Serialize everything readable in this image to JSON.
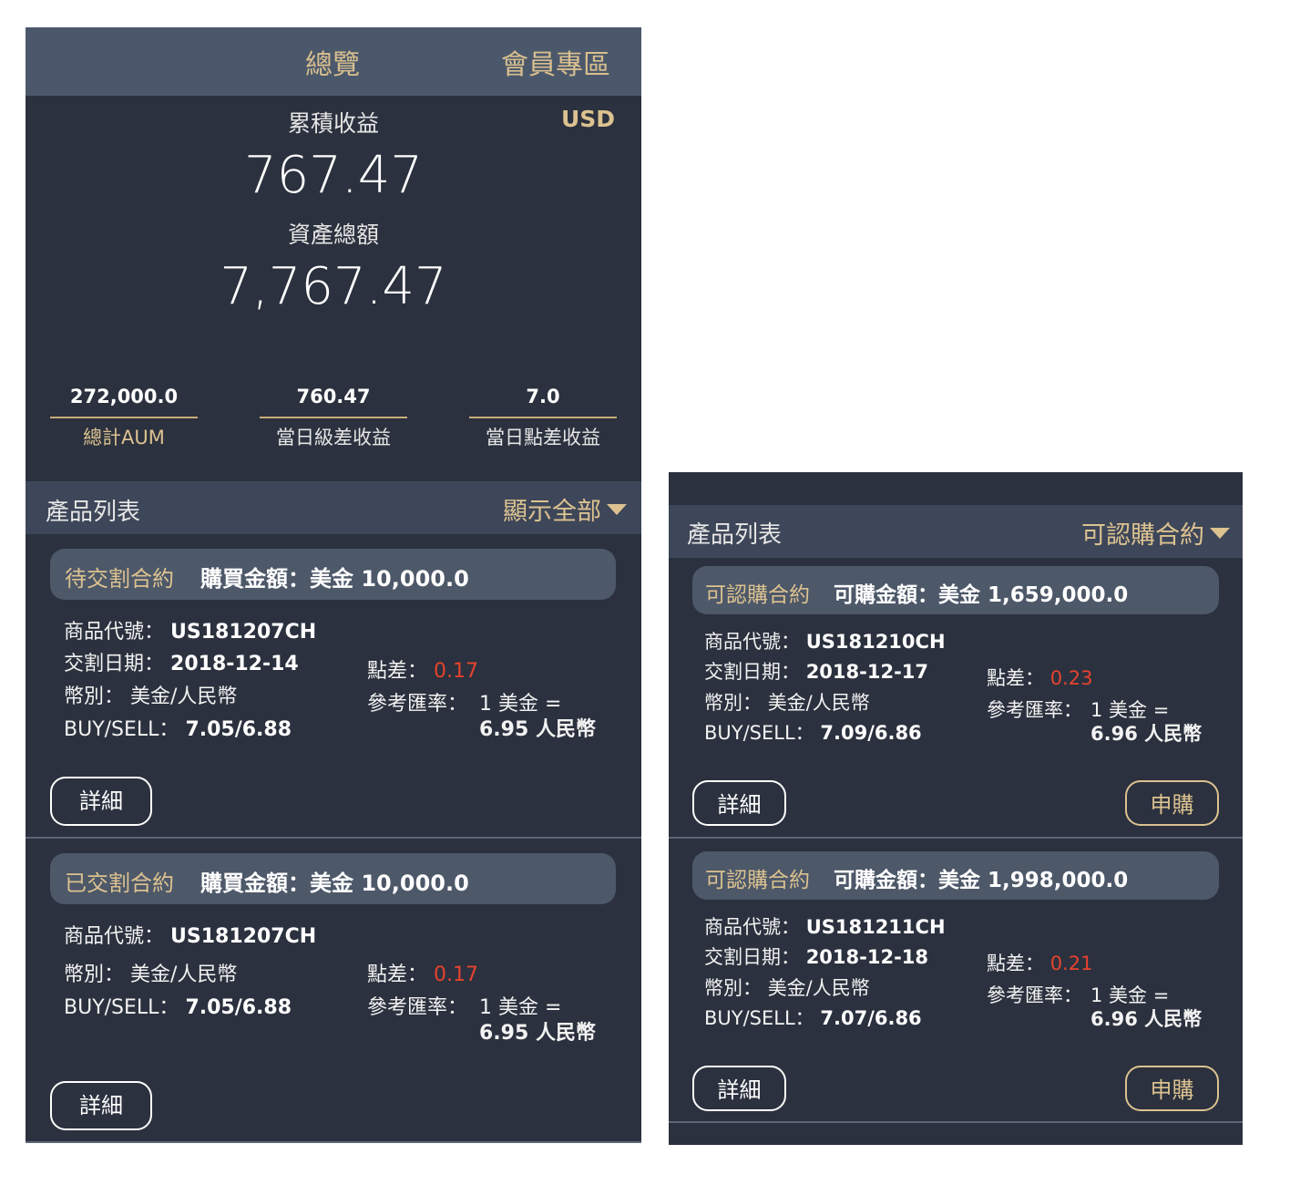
{
  "overview": {
    "tab_overview": "總覽",
    "tab_member": "會員專區",
    "accumulated_label": "累積收益",
    "currency": "USD",
    "accumulated_value": "767.47",
    "total_assets_label": "資產總額",
    "total_assets_value": "7,767.47",
    "stats": [
      {
        "value": "272,000.0",
        "label": "總計AUM"
      },
      {
        "value": "760.47",
        "label": "當日級差收益"
      },
      {
        "value": "7.0",
        "label": "當日點差收益"
      }
    ]
  },
  "left_list": {
    "title": "產品列表",
    "filter": "顯示全部",
    "cards": [
      {
        "kind": "待交割合約",
        "amount": "購買金額：美金 10,000.0",
        "code_label": "商品代號：",
        "code": "US181207CH",
        "date_label": "交割日期：",
        "date": "2018-12-14",
        "currency_label": "幣別：",
        "currency": "美金/人民幣",
        "bs_label": "BUY/SELL：",
        "bs": "7.05/6.88",
        "spread_label": "點差：",
        "spread": "0.17",
        "rate_label": "參考匯率：",
        "rate_line1": "1 美金 =",
        "rate_line2": "6.95 人民幣",
        "detail": "詳細"
      },
      {
        "kind": "已交割合約",
        "amount": "購買金額：美金 10,000.0",
        "code_label": "商品代號：",
        "code": "US181207CH",
        "currency_label": "幣別：",
        "currency": "美金/人民幣",
        "bs_label": "BUY/SELL：",
        "bs": "7.05/6.88",
        "spread_label": "點差：",
        "spread": "0.17",
        "rate_label": "參考匯率：",
        "rate_line1": "1 美金 =",
        "rate_line2": "6.95 人民幣",
        "detail": "詳細"
      }
    ]
  },
  "right_list": {
    "title": "產品列表",
    "filter": "可認購合約",
    "cards": [
      {
        "kind": "可認購合約",
        "amount": "可購金額：美金 1,659,000.0",
        "code_label": "商品代號：",
        "code": "US181210CH",
        "date_label": "交割日期：",
        "date": "2018-12-17",
        "currency_label": "幣別：",
        "currency": "美金/人民幣",
        "bs_label": "BUY/SELL：",
        "bs": "7.09/6.86",
        "spread_label": "點差：",
        "spread": "0.23",
        "rate_label": "參考匯率：",
        "rate_line1": "1 美金 =",
        "rate_line2": "6.96 人民幣",
        "detail": "詳細",
        "buy": "申購"
      },
      {
        "kind": "可認購合約",
        "amount": "可購金額：美金 1,998,000.0",
        "code_label": "商品代號：",
        "code": "US181211CH",
        "date_label": "交割日期：",
        "date": "2018-12-18",
        "currency_label": "幣別：",
        "currency": "美金/人民幣",
        "bs_label": "BUY/SELL：",
        "bs": "7.07/6.86",
        "spread_label": "點差：",
        "spread": "0.21",
        "rate_label": "參考匯率：",
        "rate_line1": "1 美金 =",
        "rate_line2": "6.96 人民幣",
        "detail": "詳細",
        "buy": "申購"
      }
    ]
  }
}
